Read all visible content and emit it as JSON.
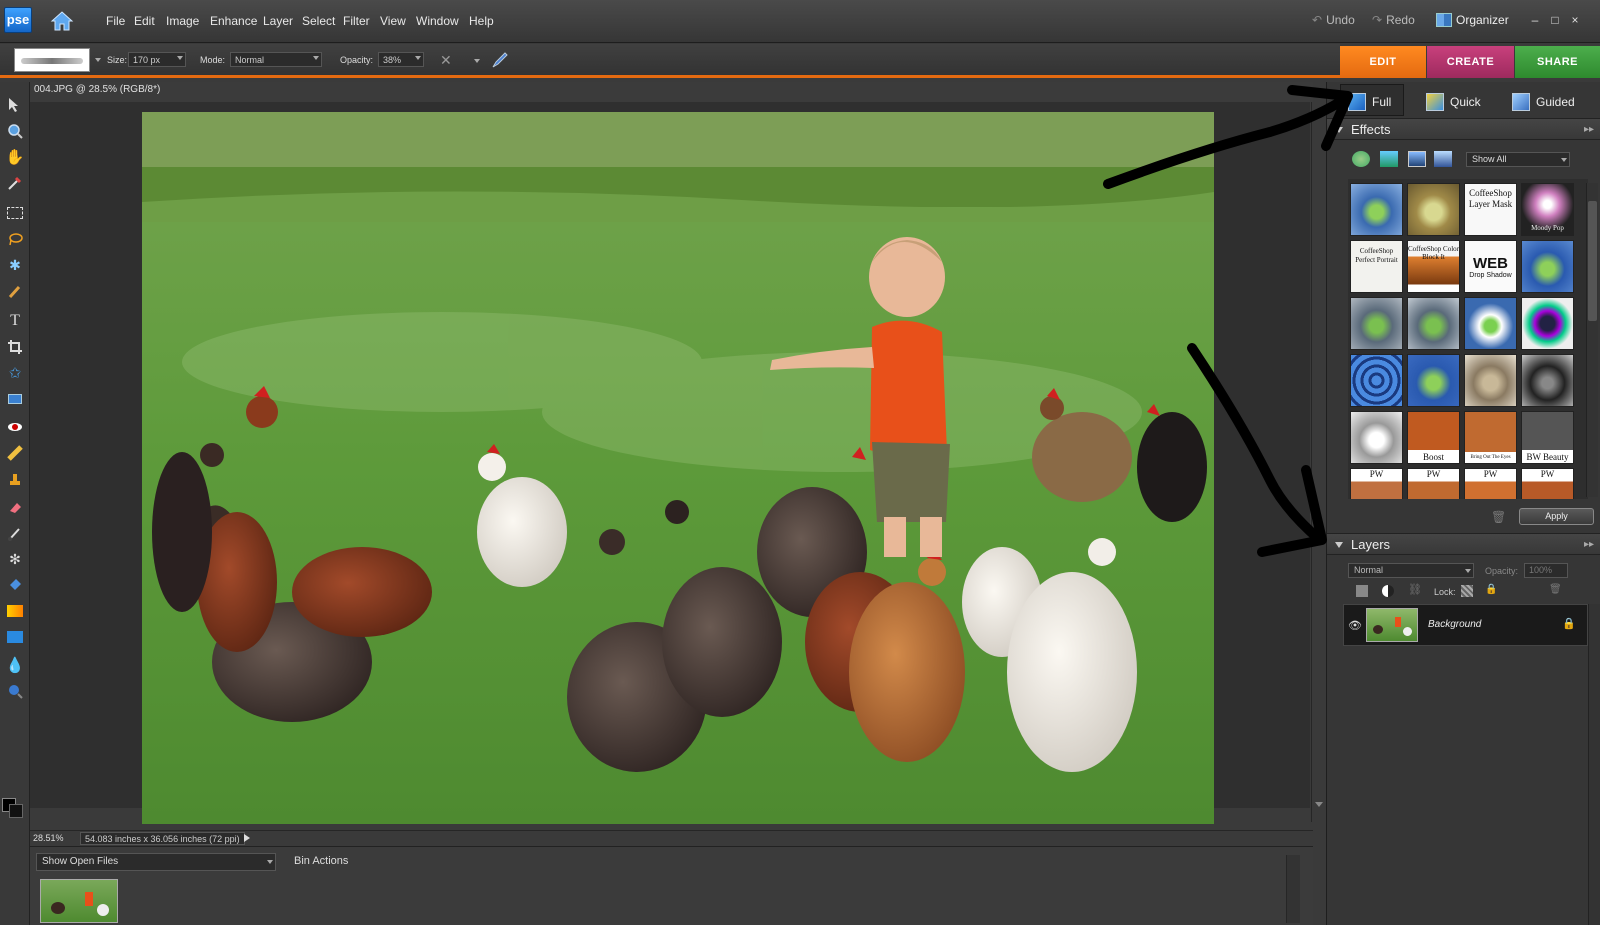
{
  "app": {
    "logo": "pse",
    "title_icon": "home-icon"
  },
  "menu": [
    "File",
    "Edit",
    "Image",
    "Enhance",
    "Layer",
    "Select",
    "Filter",
    "View",
    "Window",
    "Help"
  ],
  "top_right": {
    "undo": "Undo",
    "redo": "Redo",
    "organizer": "Organizer"
  },
  "mode_tabs": {
    "edit": "EDIT",
    "create": "CREATE",
    "share": "SHARE"
  },
  "options": {
    "size_label": "Size:",
    "size_value": "170 px",
    "mode_label": "Mode:",
    "mode_value": "Normal",
    "opacity_label": "Opacity:",
    "opacity_value": "38%"
  },
  "document": {
    "title": "004.JPG @ 28.5% (RGB/8*)"
  },
  "status": {
    "zoom": "28.51%",
    "dimensions": "54.083 inches x 36.056 inches (72 ppi)"
  },
  "bin": {
    "show_files": "Show Open Files",
    "actions": "Bin Actions"
  },
  "subtabs": {
    "full": "Full",
    "quick": "Quick",
    "guided": "Guided"
  },
  "effects": {
    "title": "Effects",
    "filter": "Show All",
    "apply": "Apply",
    "thumb_labels": {
      "layer_mask": "CoffeeShop Layer Mask",
      "moody": "Moody Pop",
      "perfect_portrait": "CoffeeShop Perfect Portrait",
      "color_block": "CoffeeShop Color Block It",
      "web": "WEB",
      "drop_shadow": "Drop Shadow",
      "boost": "Boost",
      "bring_out": "Bring Out The Eyes",
      "bw_beauty": "BW Beauty",
      "pw": "PW"
    }
  },
  "layers": {
    "title": "Layers",
    "blend": "Normal",
    "opacity_label": "Opacity:",
    "opacity_value": "100%",
    "lock_label": "Lock:",
    "items": [
      {
        "name": "Background"
      }
    ]
  },
  "colors": {
    "edit": "#f07a14",
    "create": "#b0306a",
    "share": "#3a9a3a",
    "accent_bar": "#e46a10"
  }
}
